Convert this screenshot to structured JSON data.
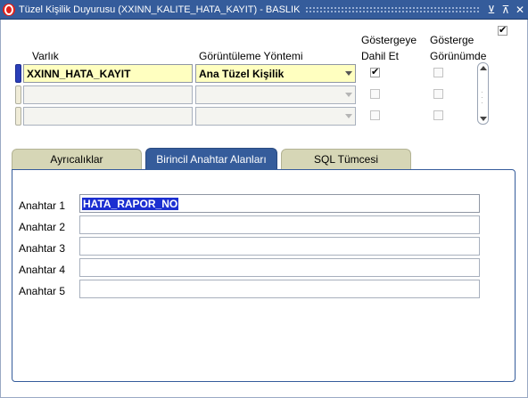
{
  "window": {
    "title": "Tüzel Kişilik Duyurusu (XXINN_KALITE_HATA_KAYIT) - BASLIK"
  },
  "header": {
    "col_varlik": "Varlık",
    "col_yontem": "Görüntüleme Yöntemi",
    "col_dahil_line1": "Göstergeye",
    "col_dahil_line2": "Dahil Et",
    "col_gorunum_line1": "Gösterge",
    "col_gorunum_line2": "Görünümde"
  },
  "rows": [
    {
      "varlik": "XXINN_HATA_KAYIT",
      "yontem": "Ana Tüzel Kişilik",
      "dahil": true,
      "gorunum": false
    },
    {
      "varlik": "",
      "yontem": "",
      "dahil": false,
      "gorunum": false
    },
    {
      "varlik": "",
      "yontem": "",
      "dahil": false,
      "gorunum": false
    }
  ],
  "tabs": [
    {
      "label": "Ayrıcalıklar",
      "selected": false
    },
    {
      "label": "Birincil Anahtar Alanları",
      "selected": true
    },
    {
      "label": "SQL Tümcesi",
      "selected": false
    }
  ],
  "keys": [
    {
      "label": "Anahtar 1",
      "value": "HATA_RAPOR_NO"
    },
    {
      "label": "Anahtar 2",
      "value": ""
    },
    {
      "label": "Anahtar 3",
      "value": ""
    },
    {
      "label": "Anahtar 4",
      "value": ""
    },
    {
      "label": "Anahtar 5",
      "value": ""
    }
  ],
  "colors": {
    "titlebar": "#355c9b",
    "active_field": "#ffffc0",
    "selection": "#1c2fd1",
    "tab_inactive": "#d6d6b6"
  }
}
